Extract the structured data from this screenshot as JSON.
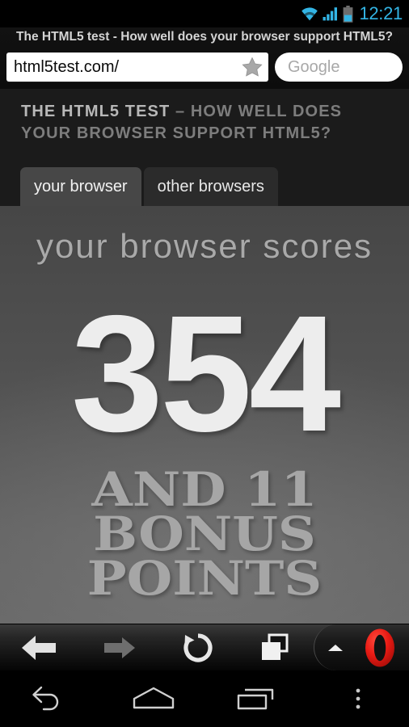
{
  "statusbar": {
    "time": "12:21",
    "icons": [
      "wifi-icon",
      "signal-icon",
      "battery-icon"
    ],
    "accent_color": "#33b5e5"
  },
  "browser_chrome": {
    "page_title": "The HTML5 test - How well does your browser support HTML5?",
    "url_value": "html5test.com/",
    "bookmark_icon": "star-icon",
    "search_placeholder": "Google"
  },
  "webpage": {
    "site_title_strong": "THE HTML5 TEST",
    "site_title_rest": " – HOW WELL DOES YOUR BROWSER SUPPORT HTML5?",
    "tabs": [
      {
        "label": "your browser",
        "active": true
      },
      {
        "label": "other browsers",
        "active": false
      }
    ],
    "scores_label": "your browser scores",
    "score": "354",
    "bonus_line1": "AND 11",
    "bonus_line2": "BONUS",
    "bonus_line3": "POINTS",
    "bonus_points": "11",
    "background_top": "#464646",
    "background_bottom": "#656565",
    "score_color": "#ededed",
    "bonus_color": "#a6a6a6"
  },
  "opera_toolbar": {
    "back_label": "Back",
    "back_icon": "arrow-left-icon",
    "forward_label": "Forward",
    "forward_icon": "arrow-right-icon",
    "reload_label": "Reload",
    "reload_icon": "refresh-icon",
    "tabs_label": "Tabs",
    "tabs_icon": "windows-icon",
    "expand_label": "Show toolbar",
    "expand_icon": "chevron-up-icon",
    "menu_label": "Opera menu",
    "menu_icon": "opera-logo-icon",
    "opera_red": "#e62222"
  },
  "android_navbar": {
    "back_label": "Back",
    "back_icon": "nav-back-icon",
    "home_label": "Home",
    "home_icon": "nav-home-icon",
    "recents_label": "Recent apps",
    "recents_icon": "nav-recents-icon",
    "menu_label": "Menu",
    "menu_icon": "nav-overflow-icon"
  }
}
